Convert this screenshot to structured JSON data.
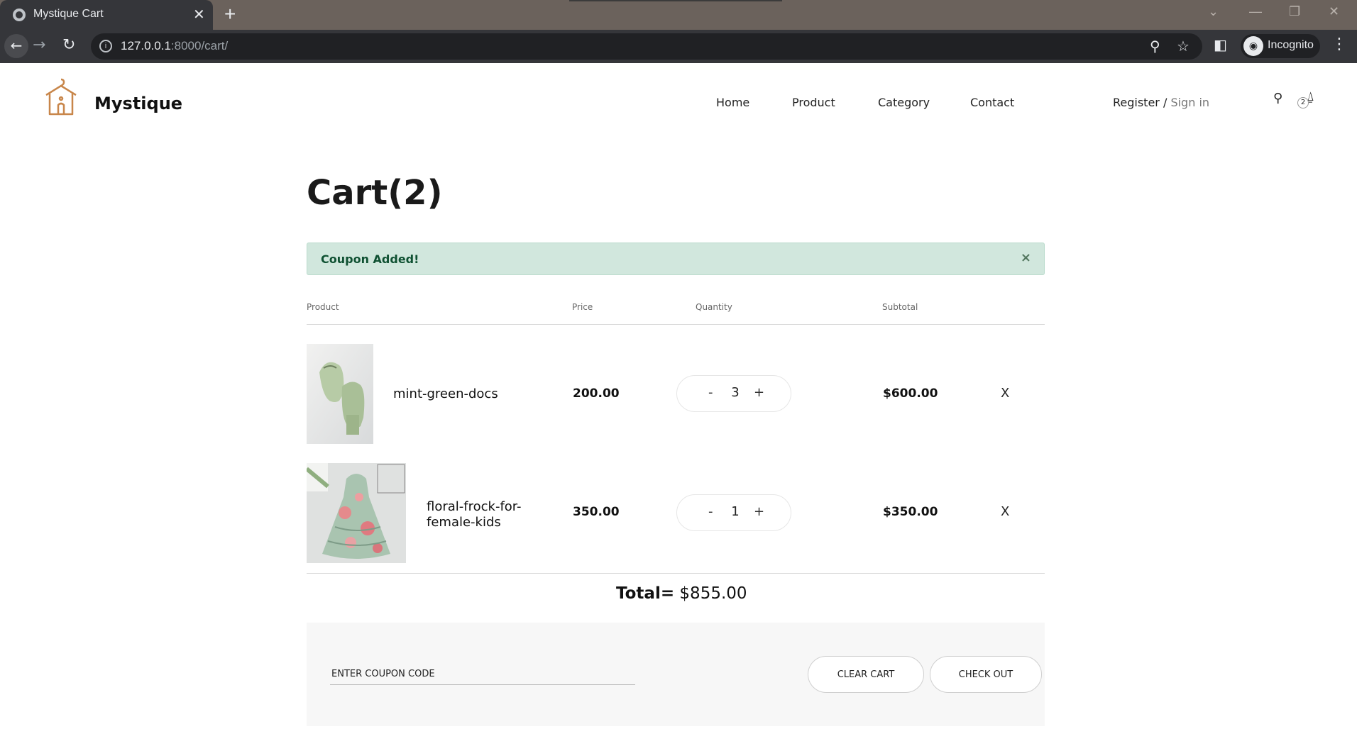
{
  "browser": {
    "tab_title": "Mystique Cart",
    "url_host": "127.0.0.1",
    "url_path": ":8000/cart/",
    "incognito_label": "Incognito"
  },
  "site": {
    "brand": "Mystique",
    "nav": [
      "Home",
      "Product",
      "Category",
      "Contact"
    ],
    "register": "Register",
    "separator": "/",
    "signin": "Sign in",
    "cart_count": "2"
  },
  "cart": {
    "title": "Cart(2)",
    "alert": "Coupon Added!",
    "alert_close": "×",
    "headers": {
      "product": "Product",
      "price": "Price",
      "quantity": "Quantity",
      "subtotal": "Subtotal"
    },
    "items": [
      {
        "name": "mint-green-docs",
        "price": "200.00",
        "qty": "3",
        "subtotal": "$600.00",
        "remove": "X"
      },
      {
        "name": "floral-frock-for-female-kids",
        "name_line1": "floral-frock-for-",
        "name_line2": "female-kids",
        "price": "350.00",
        "qty": "1",
        "subtotal": "$350.00",
        "remove": "X"
      }
    ],
    "qty_minus": "-",
    "qty_plus": "+",
    "total_label": "Total=",
    "total_value": "$855.00",
    "coupon_placeholder": "ENTER COUPON CODE",
    "clear_cart": "CLEAR CART",
    "check_out": "CHECK OUT"
  },
  "colors": {
    "alert_bg": "#d1e7dd",
    "alert_text": "#0f5132",
    "logo_accent": "#c8864a"
  }
}
